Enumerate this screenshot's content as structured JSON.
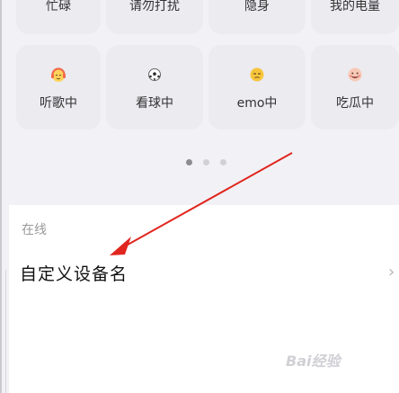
{
  "top_row": [
    {
      "label": "忙碌"
    },
    {
      "label": "请勿打扰"
    },
    {
      "label": "隐身"
    },
    {
      "label": "我的电量"
    }
  ],
  "status_tiles": [
    {
      "label": "听歌中",
      "icon": "headphones-emoji-icon",
      "color": "#f29a3d"
    },
    {
      "label": "看球中",
      "icon": "soccer-ball-icon",
      "color": "#555555"
    },
    {
      "label": "emo中",
      "icon": "smirk-emoji-icon",
      "color": "#f5c43a"
    },
    {
      "label": "吃瓜中",
      "icon": "yum-emoji-icon",
      "color": "#f08c8c"
    }
  ],
  "pager": {
    "pages": 3,
    "active": 1
  },
  "section": {
    "label": "在线"
  },
  "row": {
    "title": "自定义设备名",
    "chevron": "›"
  },
  "watermark": "Bai经验",
  "colors": {
    "accent_arrow": "#e0261f"
  }
}
